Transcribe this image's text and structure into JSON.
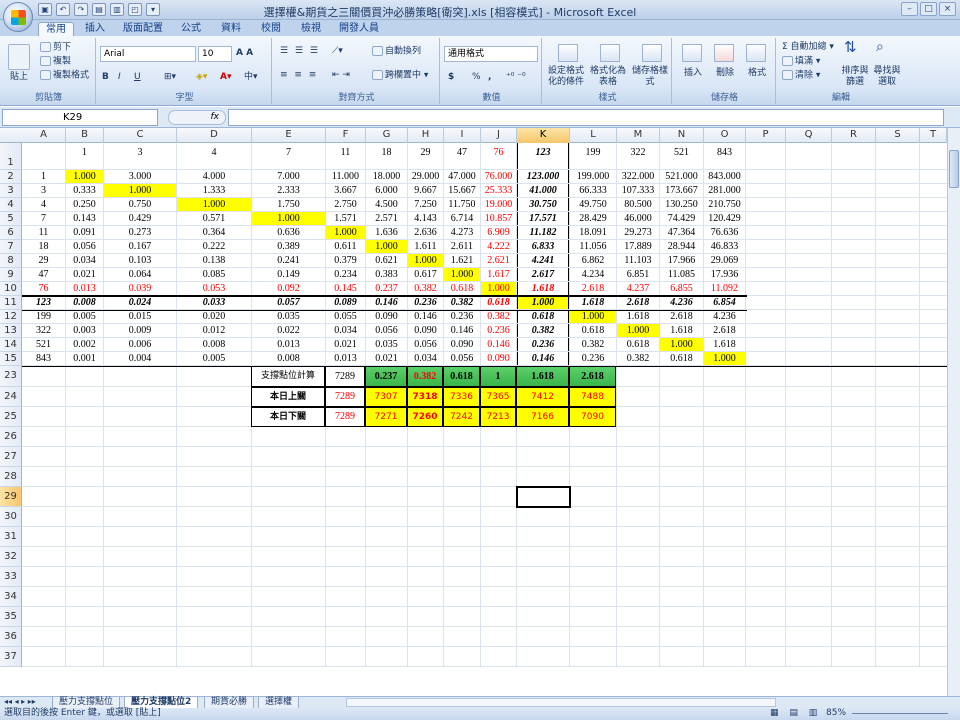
{
  "window": {
    "title": "選擇權&期貨之三關價買沖必勝策略[衛突].xls [相容模式] - Microsoft Excel",
    "controls": [
      "–",
      "□",
      "×"
    ]
  },
  "qat": [
    "save",
    "undo",
    "redo",
    "open",
    "print",
    "preview",
    "more"
  ],
  "ribbon": {
    "tabs": [
      "常用",
      "插入",
      "版面配置",
      "公式",
      "資料",
      "校閱",
      "檢視",
      "開發人員"
    ],
    "clipboard": {
      "paste": "貼上",
      "cut": "剪下",
      "copy": "複製",
      "format_painter": "複製格式",
      "label": "剪貼簿"
    },
    "font": {
      "name": "Arial",
      "size": "10",
      "bold": "B",
      "italic": "I",
      "underline": "U",
      "label": "字型"
    },
    "alignment": {
      "wrap": "自動換列",
      "merge": "跨欄置中 ▾",
      "label": "對齊方式"
    },
    "number": {
      "format": "通用格式",
      "currency": "$",
      "percent": "%",
      "comma": ",",
      "label": "數值"
    },
    "styles": {
      "conditional": "設定格式化的條件",
      "table": "格式化為表格",
      "cell": "儲存格樣式",
      "label": "樣式"
    },
    "cells": {
      "insert": "插入",
      "delete": "刪除",
      "format": "格式",
      "label": "儲存格"
    },
    "editing": {
      "autosum": "Σ 自動加總 ▾",
      "fill": "填滿 ▾",
      "clear": "清除 ▾",
      "sort": "排序與篩選",
      "find": "尋找與選取",
      "label": "編輯"
    }
  },
  "formula_bar": {
    "name_box": "K29",
    "fx": "fx",
    "value": ""
  },
  "columns": [
    "A",
    "B",
    "C",
    "D",
    "E",
    "F",
    "G",
    "H",
    "I",
    "J",
    "K",
    "L",
    "M",
    "N",
    "O",
    "P",
    "Q",
    "R",
    "S",
    "T"
  ],
  "selected_column": "K",
  "rows": {
    "r1": {
      "label": "1",
      "cells": [
        "",
        "1",
        "3",
        "4",
        "7",
        "11",
        "18",
        "29",
        "47",
        "76",
        "123",
        "199",
        "322",
        "521",
        "843"
      ]
    },
    "r2": {
      "label": "2",
      "cells": [
        "1",
        "1.000",
        "3.000",
        "4.000",
        "7.000",
        "11.000",
        "18.000",
        "29.000",
        "47.000",
        "76.000",
        "123.000",
        "199.000",
        "322.000",
        "521.000",
        "843.000"
      ]
    },
    "r3": {
      "label": "3",
      "cells": [
        "3",
        "0.333",
        "1.000",
        "1.333",
        "2.333",
        "3.667",
        "6.000",
        "9.667",
        "15.667",
        "25.333",
        "41.000",
        "66.333",
        "107.333",
        "173.667",
        "281.000"
      ]
    },
    "r4": {
      "label": "4",
      "cells": [
        "4",
        "0.250",
        "0.750",
        "1.000",
        "1.750",
        "2.750",
        "4.500",
        "7.250",
        "11.750",
        "19.000",
        "30.750",
        "49.750",
        "80.500",
        "130.250",
        "210.750"
      ]
    },
    "r5": {
      "label": "5",
      "cells": [
        "7",
        "0.143",
        "0.429",
        "0.571",
        "1.000",
        "1.571",
        "2.571",
        "4.143",
        "6.714",
        "10.857",
        "17.571",
        "28.429",
        "46.000",
        "74.429",
        "120.429"
      ]
    },
    "r6": {
      "label": "6",
      "cells": [
        "11",
        "0.091",
        "0.273",
        "0.364",
        "0.636",
        "1.000",
        "1.636",
        "2.636",
        "4.273",
        "6.909",
        "11.182",
        "18.091",
        "29.273",
        "47.364",
        "76.636"
      ]
    },
    "r7": {
      "label": "7",
      "cells": [
        "18",
        "0.056",
        "0.167",
        "0.222",
        "0.389",
        "0.611",
        "1.000",
        "1.611",
        "2.611",
        "4.222",
        "6.833",
        "11.056",
        "17.889",
        "28.944",
        "46.833"
      ]
    },
    "r8": {
      "label": "8",
      "cells": [
        "29",
        "0.034",
        "0.103",
        "0.138",
        "0.241",
        "0.379",
        "0.621",
        "1.000",
        "1.621",
        "2.621",
        "4.241",
        "6.862",
        "11.103",
        "17.966",
        "29.069"
      ]
    },
    "r9": {
      "label": "9",
      "cells": [
        "47",
        "0.021",
        "0.064",
        "0.085",
        "0.149",
        "0.234",
        "0.383",
        "0.617",
        "1.000",
        "1.617",
        "2.617",
        "4.234",
        "6.851",
        "11.085",
        "17.936"
      ]
    },
    "r10": {
      "label": "10",
      "cells": [
        "76",
        "0.013",
        "0.039",
        "0.053",
        "0.092",
        "0.145",
        "0.237",
        "0.382",
        "0.618",
        "1.000",
        "1.618",
        "2.618",
        "4.237",
        "6.855",
        "11.092"
      ]
    },
    "r11": {
      "label": "11",
      "cells": [
        "123",
        "0.008",
        "0.024",
        "0.033",
        "0.057",
        "0.089",
        "0.146",
        "0.236",
        "0.382",
        "0.618",
        "1.000",
        "1.618",
        "2.618",
        "4.236",
        "6.854"
      ]
    },
    "r12": {
      "label": "12",
      "cells": [
        "199",
        "0.005",
        "0.015",
        "0.020",
        "0.035",
        "0.055",
        "0.090",
        "0.146",
        "0.236",
        "0.382",
        "0.618",
        "1.000",
        "1.618",
        "2.618",
        "4.236"
      ]
    },
    "r13": {
      "label": "13",
      "cells": [
        "322",
        "0.003",
        "0.009",
        "0.012",
        "0.022",
        "0.034",
        "0.056",
        "0.090",
        "0.146",
        "0.236",
        "0.382",
        "0.618",
        "1.000",
        "1.618",
        "2.618"
      ]
    },
    "r14": {
      "label": "14",
      "cells": [
        "521",
        "0.002",
        "0.006",
        "0.008",
        "0.013",
        "0.021",
        "0.035",
        "0.056",
        "0.090",
        "0.146",
        "0.236",
        "0.382",
        "0.618",
        "1.000",
        "1.618"
      ]
    },
    "r15": {
      "label": "15",
      "cells": [
        "843",
        "0.001",
        "0.004",
        "0.005",
        "0.008",
        "0.013",
        "0.021",
        "0.034",
        "0.056",
        "0.090",
        "0.146",
        "0.236",
        "0.382",
        "0.618",
        "1.000"
      ]
    }
  },
  "support_table": {
    "r23": {
      "label": "23",
      "cells": [
        "支撐點位計算",
        "7289",
        "0.237",
        "0.382",
        "0.618",
        "1",
        "1.618",
        "2.618"
      ]
    },
    "r24": {
      "label": "24",
      "cells": [
        "本日上關",
        "7289",
        "7307",
        "7318",
        "7336",
        "7365",
        "7412",
        "7488"
      ]
    },
    "r25": {
      "label": "25",
      "cells": [
        "本日下關",
        "7289",
        "7271",
        "7260",
        "7242",
        "7213",
        "7166",
        "7090"
      ]
    }
  },
  "empty_rows": [
    "26",
    "27",
    "28",
    "29",
    "30",
    "31",
    "32",
    "33",
    "34",
    "35",
    "36",
    "37"
  ],
  "sheets": [
    "壓力支撐點位",
    "壓力支撐點位2",
    "期貨必勝",
    "選擇權"
  ],
  "status": {
    "message": "選取目的後按 Enter 鍵，或選取 [貼上]",
    "zoom": "85%"
  },
  "colors": {
    "highlight": "#ffff00",
    "red_text": "#ff0000",
    "green_header": "#39b54a",
    "selection": "#f6c66c"
  }
}
